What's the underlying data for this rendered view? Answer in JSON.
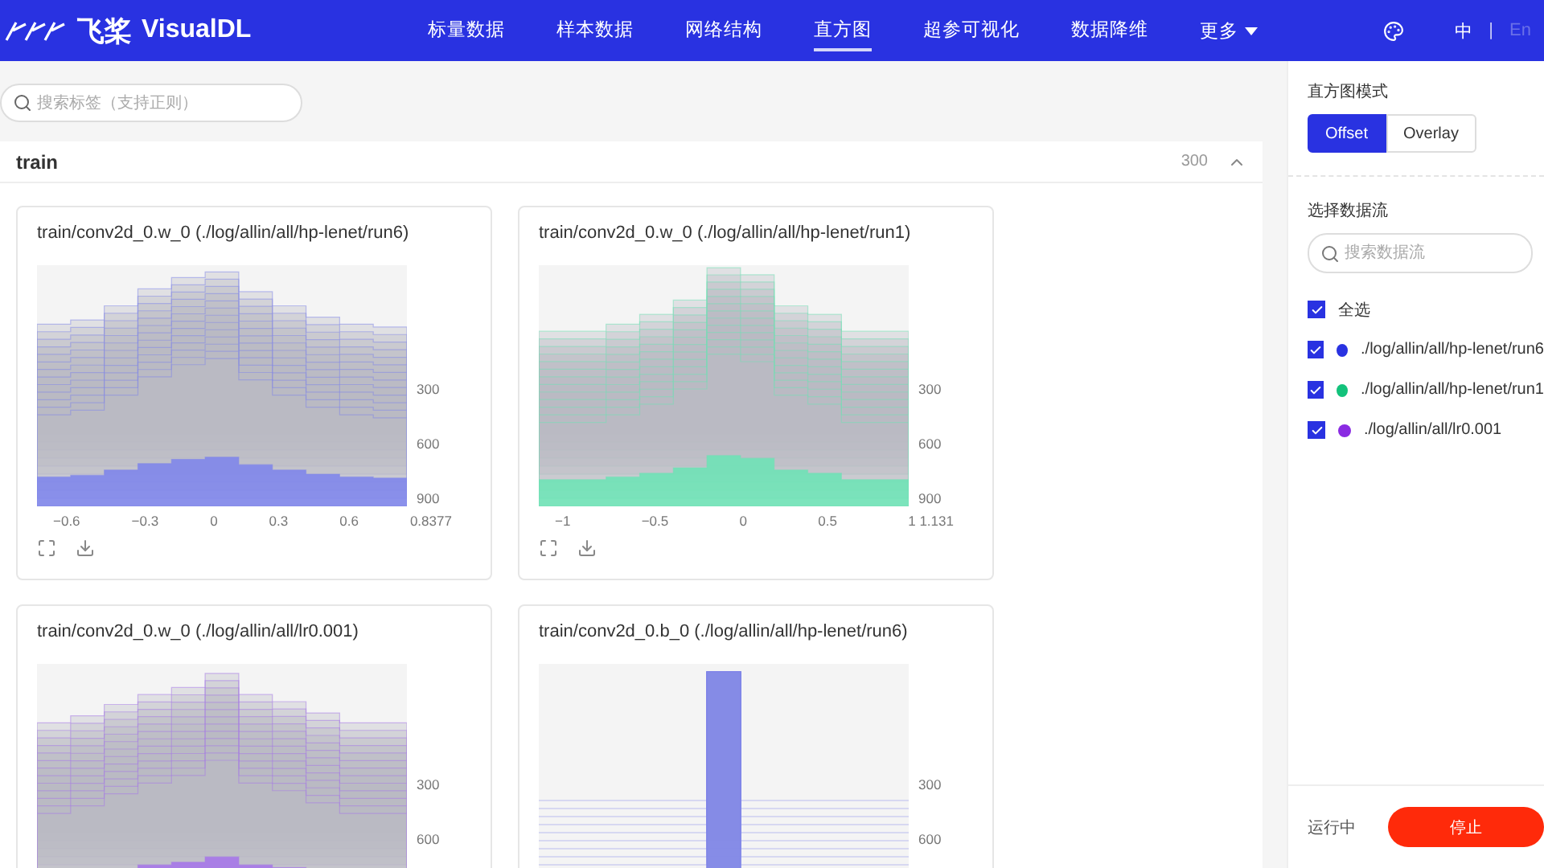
{
  "app": {
    "logo_cn": "飞桨",
    "logo_en": "VisualDL"
  },
  "nav": [
    {
      "label": "标量数据",
      "selected": false
    },
    {
      "label": "样本数据",
      "selected": false
    },
    {
      "label": "网络结构",
      "selected": false
    },
    {
      "label": "直方图",
      "selected": true
    },
    {
      "label": "超参可视化",
      "selected": false
    },
    {
      "label": "数据降维",
      "selected": false
    }
  ],
  "nav_more": "更多",
  "languages": [
    {
      "label": "中",
      "selected": true
    },
    {
      "label": "En",
      "selected": false
    }
  ],
  "language_separator": "|",
  "search": {
    "placeholder": "搜索标签（支持正则）"
  },
  "group": {
    "title": "train",
    "count": "300",
    "expanded": true
  },
  "cards": [
    {
      "title": "train/conv2d_0.w_0 (./log/allin/all/hp-lenet/run6)",
      "color": "#7f86ea",
      "x_ticks": [
        "−0.6",
        "−0.3",
        "0",
        "0.3",
        "0.6",
        "0.8377"
      ],
      "y_ticks": [
        "300",
        "600",
        "900"
      ]
    },
    {
      "title": "train/conv2d_0.w_0 (./log/allin/all/hp-lenet/run1)",
      "color": "#6fe2b6",
      "x_ticks": [
        "−1",
        "−0.5",
        "0",
        "0.5",
        "1 1.131"
      ],
      "y_ticks": [
        "300",
        "600",
        "900"
      ]
    },
    {
      "title": "train/conv2d_0.w_0 (./log/allin/all/lr0.001)",
      "color": "#a677e8",
      "y_ticks": [
        "300",
        "600"
      ]
    },
    {
      "title": "train/conv2d_0.b_0 (./log/allin/all/hp-lenet/run6)",
      "color": "#7f86ea",
      "y_ticks": [
        "300",
        "600"
      ]
    }
  ],
  "sidebar": {
    "mode_label": "直方图模式",
    "modes": [
      {
        "label": "Offset",
        "selected": true
      },
      {
        "label": "Overlay",
        "selected": false
      }
    ],
    "streams_label": "选择数据流",
    "streams_search": {
      "placeholder": "搜索数据流"
    },
    "select_all": {
      "label": "全选",
      "checked": true
    },
    "streams": [
      {
        "label": "./log/allin/all/hp-lenet/run6",
        "checked": true,
        "color": "#2932e1"
      },
      {
        "label": "./log/allin/all/hp-lenet/run1",
        "checked": true,
        "color": "#13c27b"
      },
      {
        "label": "./log/allin/all/lr0.001",
        "checked": true,
        "color": "#8a2be2"
      }
    ],
    "status": "运行中",
    "stop_button": "停止"
  }
}
